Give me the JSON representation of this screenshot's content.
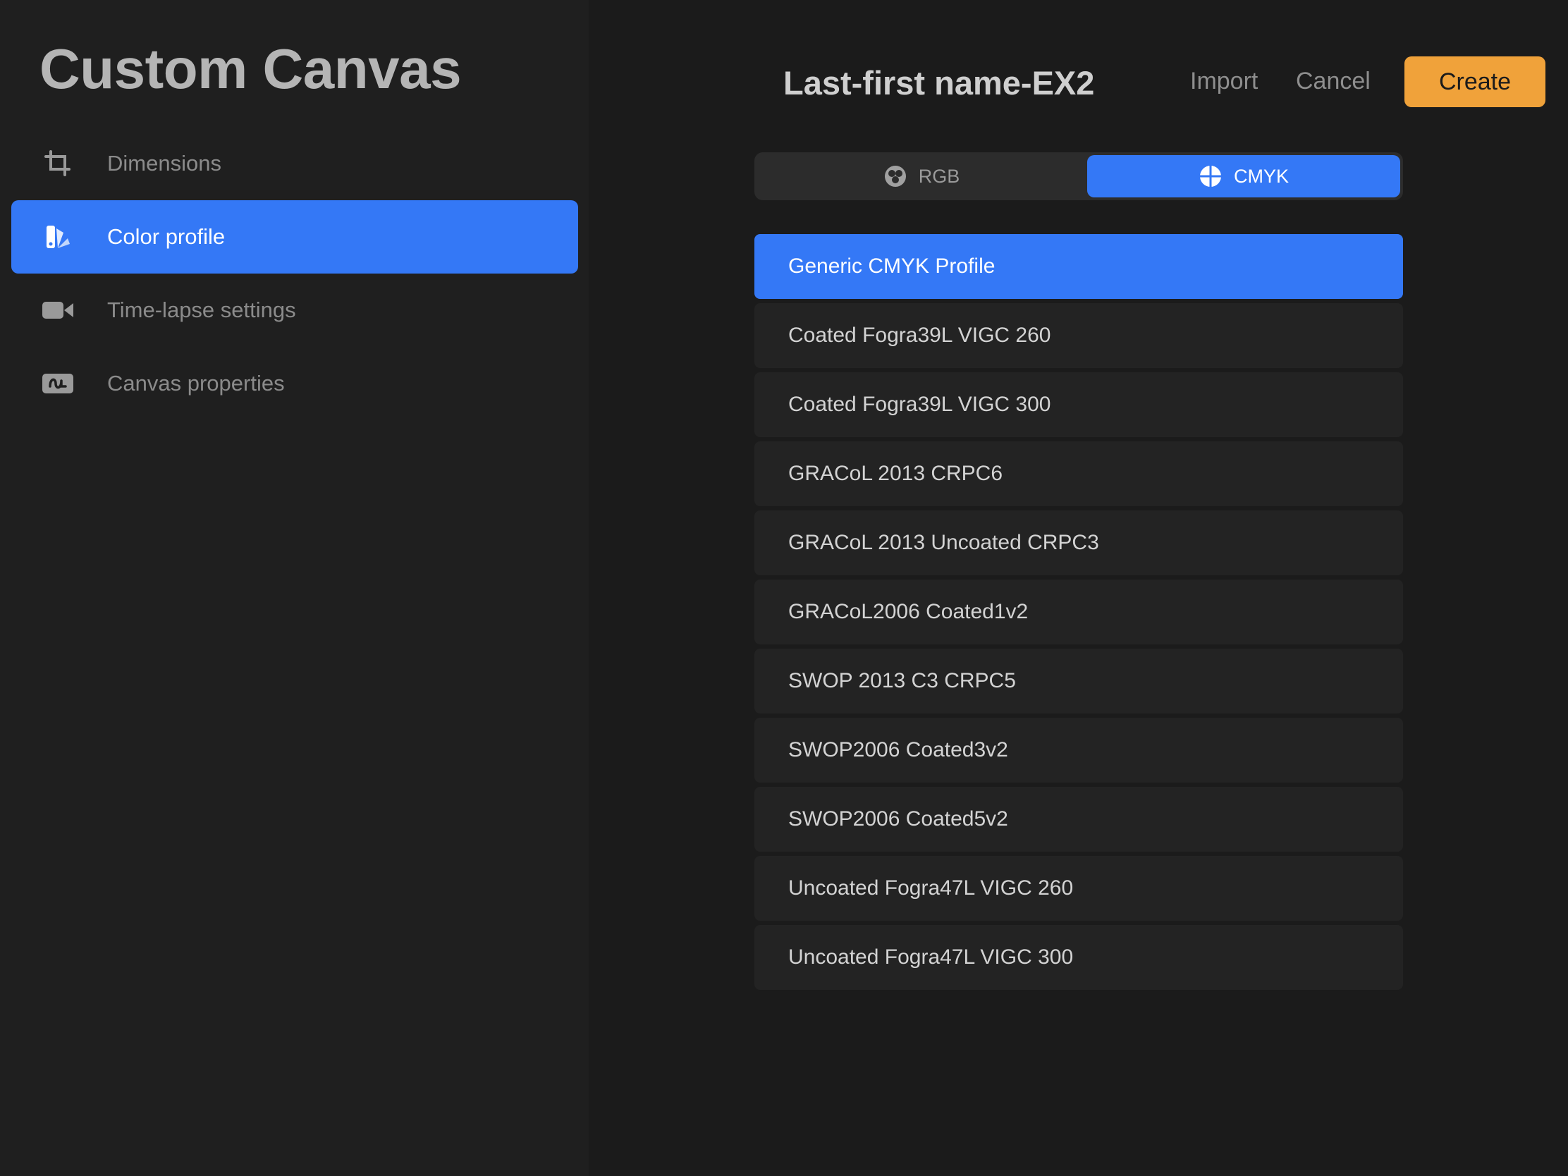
{
  "sidebar": {
    "title": "Custom Canvas",
    "items": [
      {
        "label": "Dimensions",
        "icon": "crop-icon",
        "active": false
      },
      {
        "label": "Color profile",
        "icon": "color-swatch-icon",
        "active": true
      },
      {
        "label": "Time-lapse settings",
        "icon": "video-camera-icon",
        "active": false
      },
      {
        "label": "Canvas properties",
        "icon": "canvas-properties-icon",
        "active": false
      }
    ]
  },
  "header": {
    "document_title": "Last-first name-EX2",
    "import_label": "Import",
    "cancel_label": "Cancel",
    "create_label": "Create"
  },
  "color_mode": {
    "options": [
      "RGB",
      "CMYK"
    ],
    "selected": "CMYK"
  },
  "profiles": {
    "selected": "Generic CMYK Profile",
    "items": [
      "Generic CMYK Profile",
      "Coated Fogra39L VIGC 260",
      "Coated Fogra39L VIGC 300",
      "GRACoL 2013 CRPC6",
      "GRACoL 2013 Uncoated CRPC3",
      "GRACoL2006 Coated1v2",
      "SWOP 2013 C3 CRPC5",
      "SWOP2006 Coated3v2",
      "SWOP2006 Coated5v2",
      "Uncoated Fogra47L VIGC 260",
      "Uncoated Fogra47L VIGC 300"
    ]
  },
  "colors": {
    "accent": "#3478f6",
    "create_button": "#f0a23a",
    "background": "#1f1f1f"
  }
}
